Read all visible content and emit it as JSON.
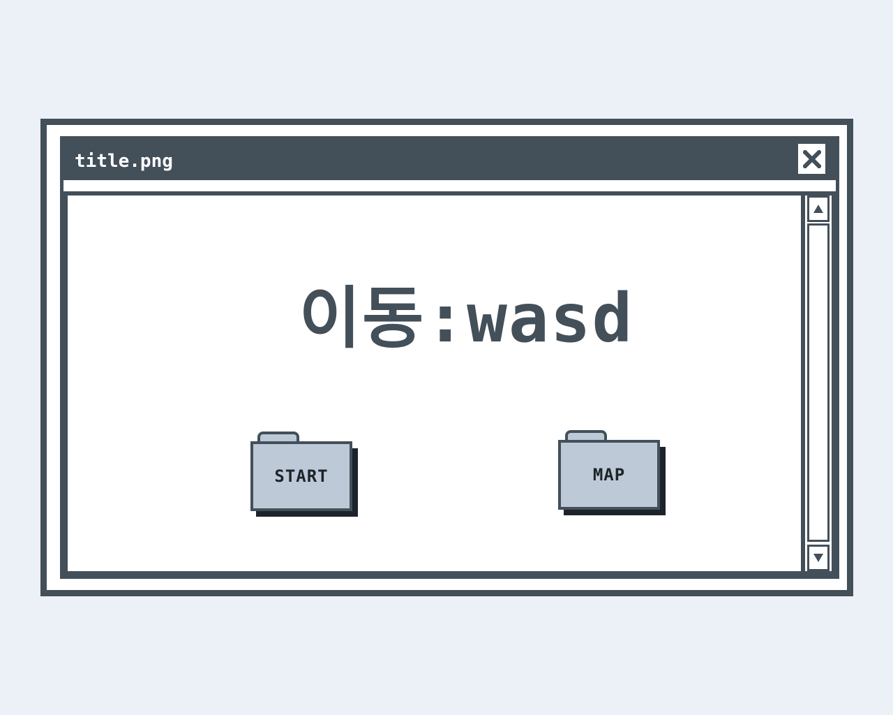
{
  "window": {
    "title": "title.png"
  },
  "content": {
    "heading": "이동:wasd"
  },
  "folders": [
    {
      "label": "START"
    },
    {
      "label": "MAP"
    }
  ],
  "icons": {
    "close": "close-icon",
    "scroll_up": "arrow-up-icon",
    "scroll_down": "arrow-down-icon"
  },
  "colors": {
    "frame": "#434f59",
    "background": "#ecf1f8",
    "folder": "#bdc9d6",
    "shadow": "#1d232a"
  }
}
